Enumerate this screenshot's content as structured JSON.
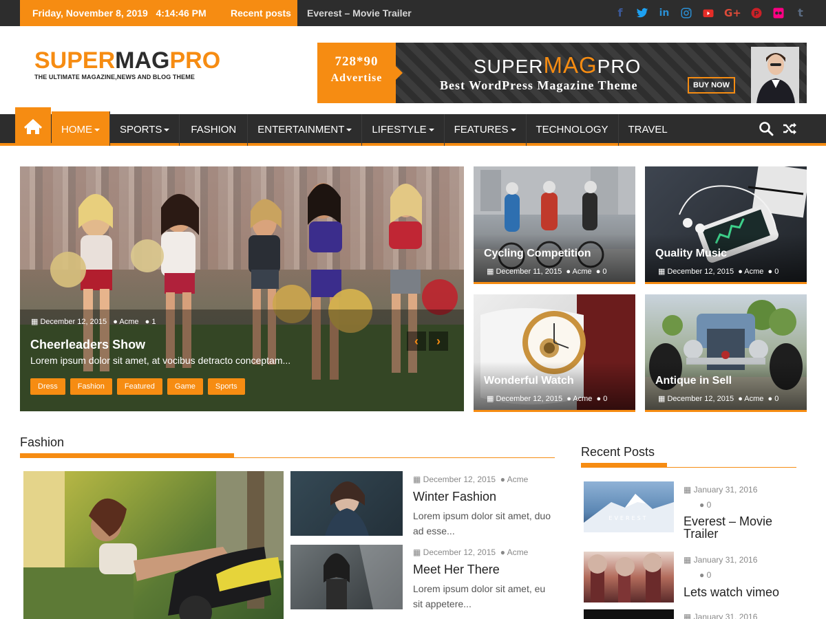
{
  "topbar": {
    "date": "Friday, November 8, 2019",
    "time": "4:14:46 PM",
    "recent_label": "Recent posts",
    "ticker": "Everest – Movie Trailer",
    "social": [
      {
        "icon": "facebook-icon",
        "glyph": "f",
        "color": "#3b5998"
      },
      {
        "icon": "twitter-icon",
        "glyph": "t",
        "color": "#1da1f2"
      },
      {
        "icon": "linkedin-icon",
        "glyph": "in",
        "color": "#0e76a8"
      },
      {
        "icon": "instagram-icon",
        "glyph": "◎",
        "color": "#2a8fd4"
      },
      {
        "icon": "youtube-icon",
        "glyph": "▶",
        "color": "#e52d27"
      },
      {
        "icon": "google-plus-icon",
        "glyph": "G+",
        "color": "#dd4b39"
      },
      {
        "icon": "pinterest-icon",
        "glyph": "P",
        "color": "#cb2027"
      },
      {
        "icon": "flickr-icon",
        "glyph": "●●",
        "color": "#ff0084"
      },
      {
        "icon": "tumblr-icon",
        "glyph": "t",
        "color": "#35465c"
      }
    ]
  },
  "header": {
    "logo_part1": "SUPER",
    "logo_part2": "MAG",
    "logo_part3": "PRO",
    "logo_tagline": "THE ULTIMATE MAGAZINE,NEWS AND BLOG THEME",
    "banner": {
      "size": "728*90",
      "advertise": "Advertise",
      "title_a": "SUPER",
      "title_b": "MAG",
      "title_c": "PRO",
      "subtitle": "Best WordPress Magazine Theme",
      "buy_label": "BUY NOW"
    }
  },
  "nav": {
    "items": [
      {
        "label": "HOME",
        "dropdown": true,
        "active": true
      },
      {
        "label": "SPORTS",
        "dropdown": true
      },
      {
        "label": "FASHION",
        "dropdown": false
      },
      {
        "label": "ENTERTAINMENT",
        "dropdown": true
      },
      {
        "label": "LIFESTYLE",
        "dropdown": true
      },
      {
        "label": "FEATURES",
        "dropdown": true
      },
      {
        "label": "TECHNOLOGY",
        "dropdown": false
      },
      {
        "label": "TRAVEL",
        "dropdown": false
      }
    ]
  },
  "featured": {
    "main": {
      "date": "December 12, 2015",
      "author": "Acme",
      "comments": "1",
      "title": "Cheerleaders Show",
      "excerpt": "Lorem ipsum dolor sit amet, at vocibus detracto conceptam...",
      "tags": [
        "Dress",
        "Fashion",
        "Featured",
        "Game",
        "Sports"
      ]
    },
    "cards": [
      {
        "title": "Cycling Competition",
        "date": "December 11, 2015",
        "author": "Acme",
        "comments": "0"
      },
      {
        "title": "Quality Music",
        "date": "December 12, 2015",
        "author": "Acme",
        "comments": "0"
      },
      {
        "title": "Wonderful Watch",
        "date": "December 12, 2015",
        "author": "Acme",
        "comments": "0"
      },
      {
        "title": "Antique in Sell",
        "date": "December 12, 2015",
        "author": "Acme",
        "comments": "0"
      }
    ]
  },
  "fashion": {
    "title": "Fashion",
    "posts": [
      {
        "date": "December 12, 2015",
        "author": "Acme",
        "title": "Winter Fashion",
        "excerpt": "Lorem ipsum dolor sit amet, duo ad esse..."
      },
      {
        "date": "December 12, 2015",
        "author": "Acme",
        "title": "Meet Her There",
        "excerpt": "Lorem ipsum dolor sit amet, eu sit appetere..."
      }
    ]
  },
  "sidebar": {
    "title": "Recent Posts",
    "posts": [
      {
        "date": "January 31, 2016",
        "comments": "0",
        "title": "Everest – Movie Trailer",
        "thumb_text": "EVEREST"
      },
      {
        "date": "January 31, 2016",
        "comments": "0",
        "title": "Lets watch vimeo"
      },
      {
        "date": "January 31, 2016"
      }
    ]
  },
  "colors": {
    "accent": "#f68c12",
    "dark": "#2d2d2d"
  }
}
